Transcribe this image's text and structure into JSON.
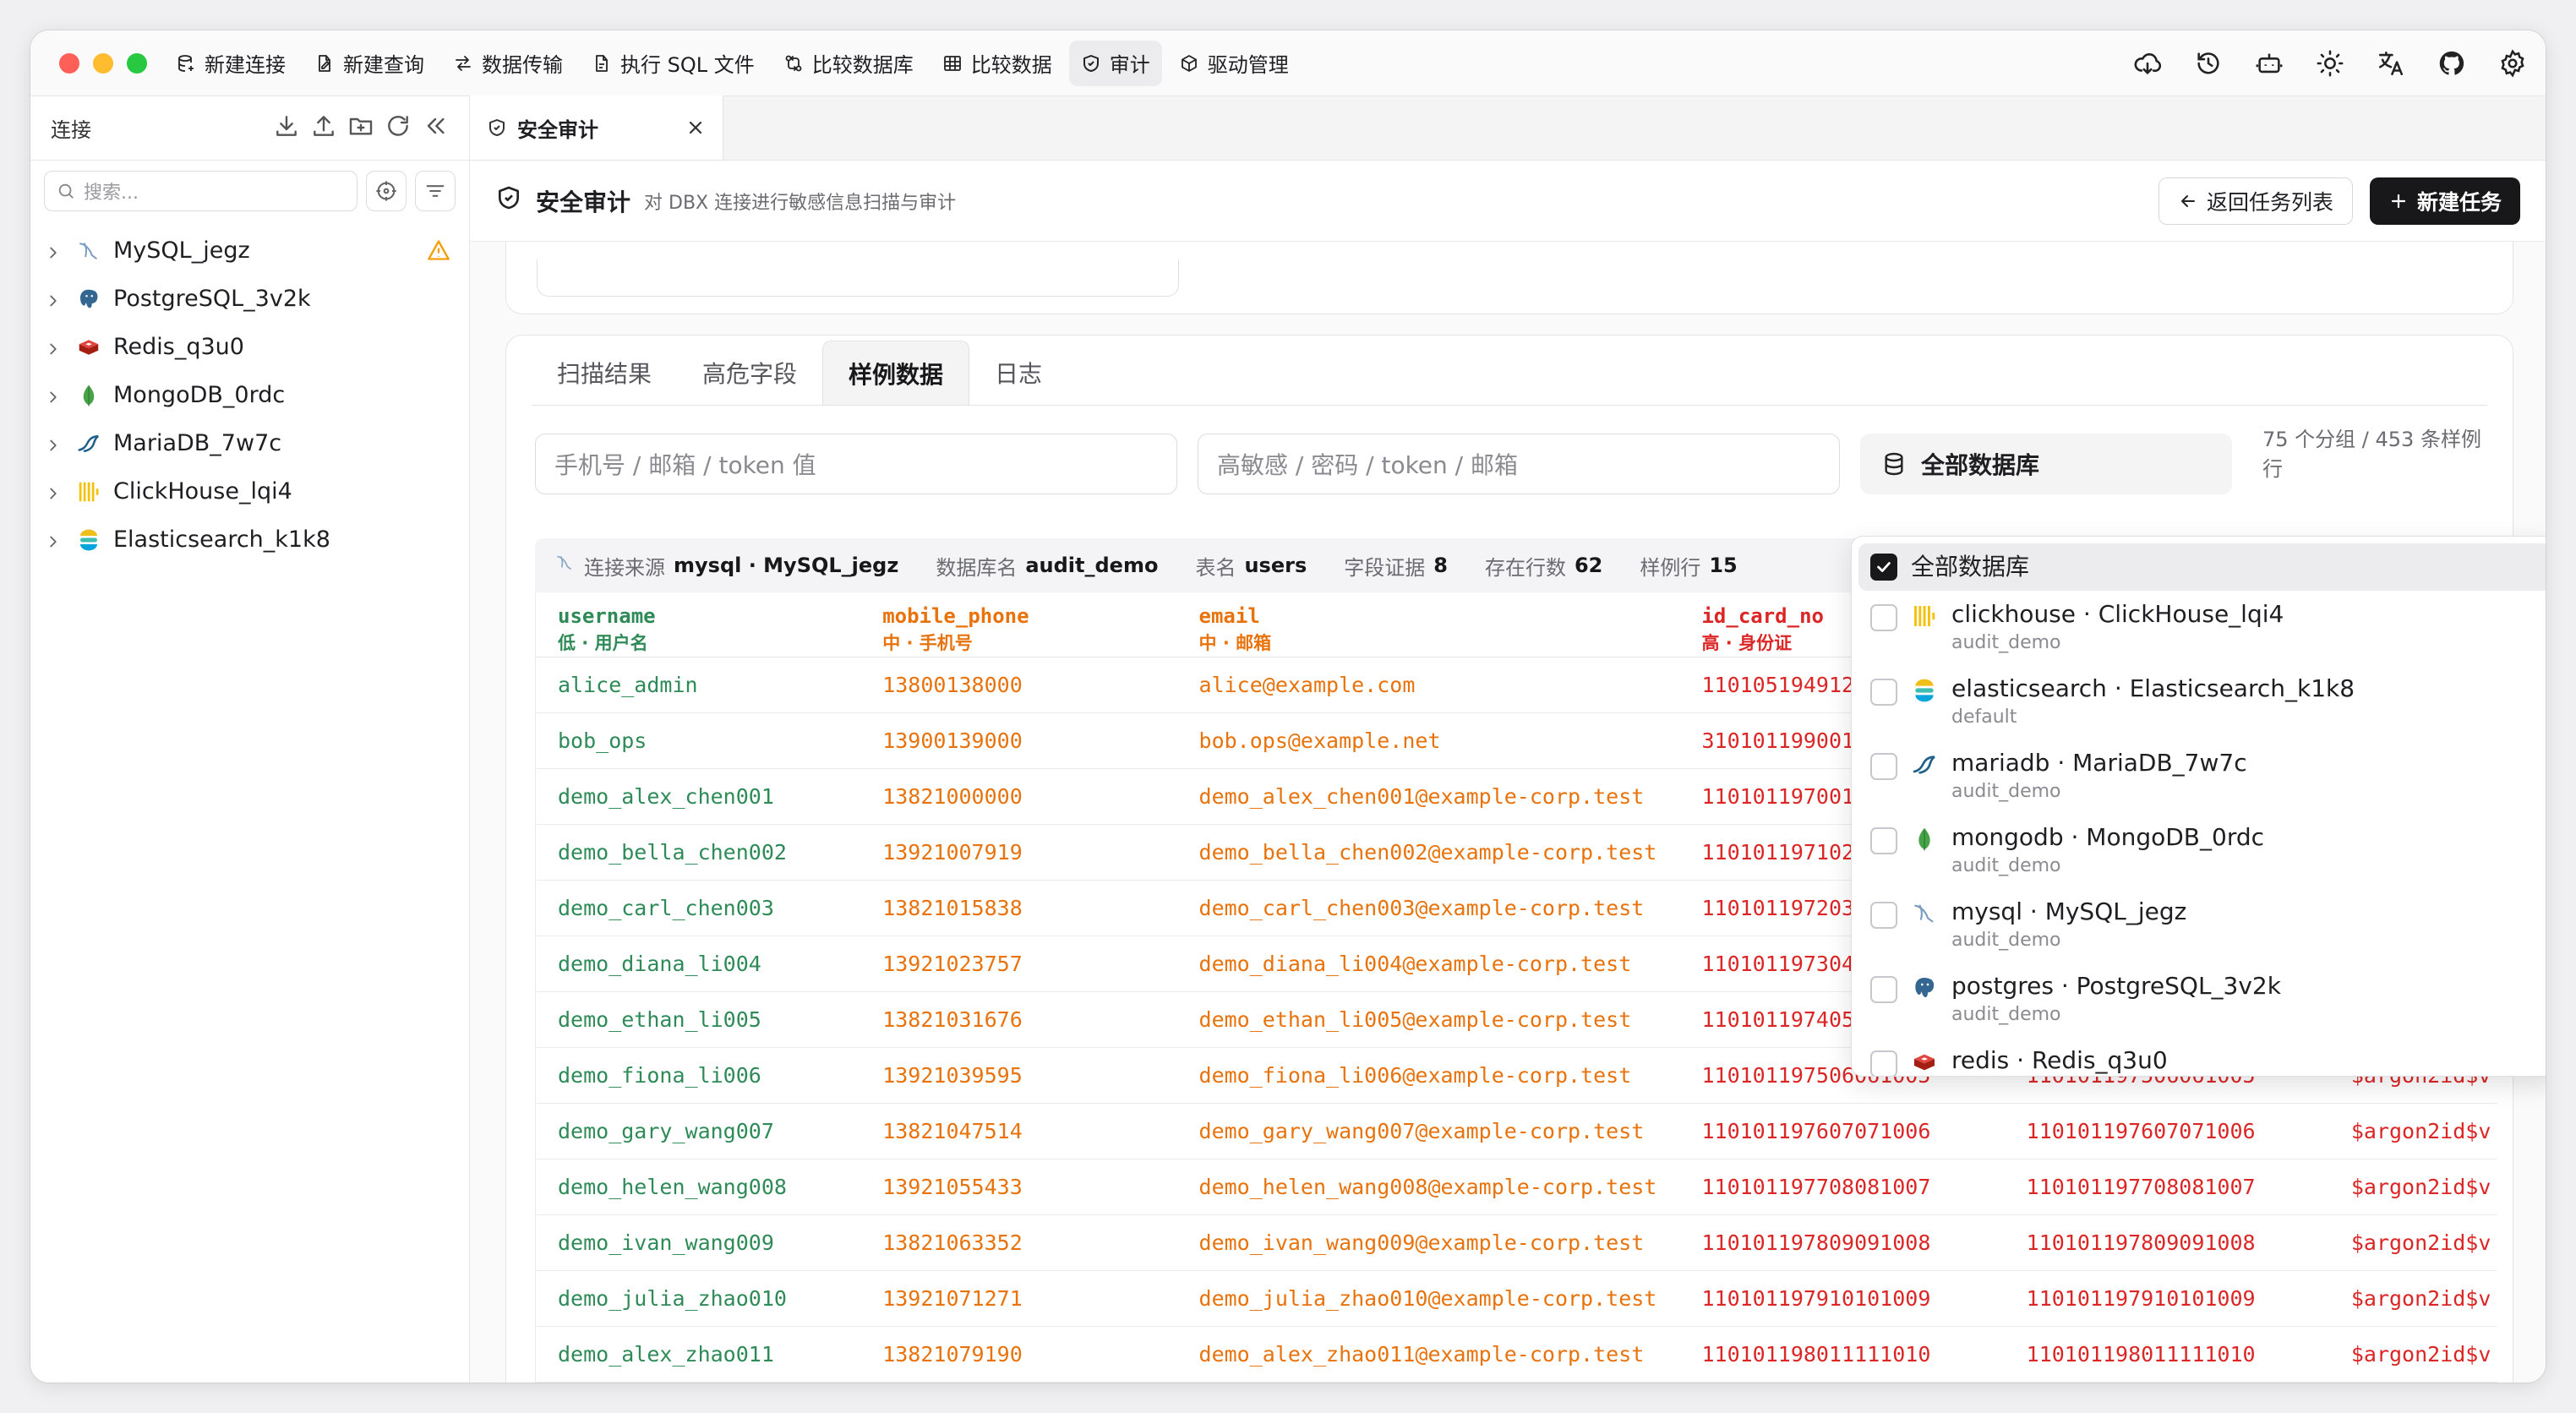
{
  "toolbar": {
    "items": [
      {
        "label": "新建连接",
        "icon": "database-plus-icon"
      },
      {
        "label": "新建查询",
        "icon": "file-edit-icon"
      },
      {
        "label": "数据传输",
        "icon": "transfer-icon"
      },
      {
        "label": "执行 SQL 文件",
        "icon": "sql-file-icon"
      },
      {
        "label": "比较数据库",
        "icon": "compare-db-icon"
      },
      {
        "label": "比较数据",
        "icon": "table-compare-icon"
      },
      {
        "label": "审计",
        "icon": "shield-icon"
      },
      {
        "label": "驱动管理",
        "icon": "package-icon"
      }
    ],
    "active_index": 6,
    "right_icons": [
      "cloud-sync-icon",
      "history-icon",
      "robot-icon",
      "sun-icon",
      "translate-icon",
      "github-icon",
      "settings-icon"
    ]
  },
  "sidebar": {
    "title": "连接",
    "search_placeholder": "搜索...",
    "connections": [
      {
        "name": "MySQL_jegz",
        "icon": "mysql-icon",
        "warning": true
      },
      {
        "name": "PostgreSQL_3v2k",
        "icon": "postgres-icon",
        "warning": false
      },
      {
        "name": "Redis_q3u0",
        "icon": "redis-icon",
        "warning": false
      },
      {
        "name": "MongoDB_0rdc",
        "icon": "mongodb-icon",
        "warning": false
      },
      {
        "name": "MariaDB_7w7c",
        "icon": "mariadb-icon",
        "warning": false
      },
      {
        "name": "ClickHouse_lqi4",
        "icon": "clickhouse-icon",
        "warning": false
      },
      {
        "name": "Elasticsearch_k1k8",
        "icon": "elasticsearch-icon",
        "warning": false
      }
    ]
  },
  "tab": {
    "label": "安全审计"
  },
  "page": {
    "title": "安全审计",
    "subtitle": "对 DBX 连接进行敏感信息扫描与审计",
    "back_button": "返回任务列表",
    "new_button": "新建任务"
  },
  "subtabs": [
    "扫描结果",
    "高危字段",
    "样例数据",
    "日志"
  ],
  "active_subtab": 2,
  "filters": {
    "search1_placeholder": "手机号 / 邮箱 / token 值",
    "search2_placeholder": "高敏感 / 密码 / token / 邮箱",
    "db_select": "全部数据库",
    "count": "75 个分组 / 453 条样例行"
  },
  "info": {
    "source_label": "连接来源",
    "source_value": "mysql · MySQL_jegz",
    "db_label": "数据库名",
    "db_value": "audit_demo",
    "table_label": "表名",
    "table_value": "users",
    "evidence_label": "字段证据",
    "evidence_value": "8",
    "rows_label": "存在行数",
    "rows_value": "62",
    "sample_label": "样例行",
    "sample_value": "15"
  },
  "colors": {
    "low": "#2e8b57",
    "medium": "#e8730c",
    "high": "#dc2626"
  },
  "table": {
    "columns": [
      {
        "name": "username",
        "sub": "低 · 用户名",
        "level": "low"
      },
      {
        "name": "mobile_phone",
        "sub": "中 · 手机号",
        "level": "medium"
      },
      {
        "name": "email",
        "sub": "中 · 邮箱",
        "level": "medium"
      },
      {
        "name": "id_card_no",
        "sub": "高 · 身份证",
        "level": "high"
      },
      {
        "name": "",
        "sub": "",
        "level": "high"
      },
      {
        "name": "",
        "sub": "",
        "level": "high"
      }
    ],
    "rows": [
      [
        "alice_admin",
        "13800138000",
        "alice@example.com",
        "110105194912310021",
        "",
        ""
      ],
      [
        "bob_ops",
        "13900139000",
        "bob.ops@example.net",
        "310101199001011234",
        "",
        ""
      ],
      [
        "demo_alex_chen001",
        "13821000000",
        "demo_alex_chen001@example-corp.test",
        "110101197001011000",
        "",
        ""
      ],
      [
        "demo_bella_chen002",
        "13921007919",
        "demo_bella_chen002@example-corp.test",
        "110101197102021001",
        "",
        ""
      ],
      [
        "demo_carl_chen003",
        "13821015838",
        "demo_carl_chen003@example-corp.test",
        "110101197203031002",
        "",
        ""
      ],
      [
        "demo_diana_li004",
        "13921023757",
        "demo_diana_li004@example-corp.test",
        "110101197304041003",
        "",
        ""
      ],
      [
        "demo_ethan_li005",
        "13821031676",
        "demo_ethan_li005@example-corp.test",
        "110101197405051004",
        "",
        ""
      ],
      [
        "demo_fiona_li006",
        "13921039595",
        "demo_fiona_li006@example-corp.test",
        "110101197506061005",
        "110101197506061005",
        "$argon2id$v"
      ],
      [
        "demo_gary_wang007",
        "13821047514",
        "demo_gary_wang007@example-corp.test",
        "110101197607071006",
        "110101197607071006",
        "$argon2id$v"
      ],
      [
        "demo_helen_wang008",
        "13921055433",
        "demo_helen_wang008@example-corp.test",
        "110101197708081007",
        "110101197708081007",
        "$argon2id$v"
      ],
      [
        "demo_ivan_wang009",
        "13821063352",
        "demo_ivan_wang009@example-corp.test",
        "110101197809091008",
        "110101197809091008",
        "$argon2id$v"
      ],
      [
        "demo_julia_zhao010",
        "13921071271",
        "demo_julia_zhao010@example-corp.test",
        "110101197910101009",
        "110101197910101009",
        "$argon2id$v"
      ],
      [
        "demo_alex_zhao011",
        "13821079190",
        "demo_alex_zhao011@example-corp.test",
        "110101198011111010",
        "110101198011111010",
        "$argon2id$v"
      ]
    ]
  },
  "dropdown": {
    "items": [
      {
        "title": "全部数据库",
        "sub": "",
        "checked": true,
        "icon": ""
      },
      {
        "title": "clickhouse · ClickHouse_lqi4",
        "sub": "audit_demo",
        "checked": false,
        "icon": "clickhouse-icon"
      },
      {
        "title": "elasticsearch · Elasticsearch_k1k8",
        "sub": "default",
        "checked": false,
        "icon": "elasticsearch-icon"
      },
      {
        "title": "mariadb · MariaDB_7w7c",
        "sub": "audit_demo",
        "checked": false,
        "icon": "mariadb-icon"
      },
      {
        "title": "mongodb · MongoDB_0rdc",
        "sub": "audit_demo",
        "checked": false,
        "icon": "mongodb-icon"
      },
      {
        "title": "mysql · MySQL_jegz",
        "sub": "audit_demo",
        "checked": false,
        "icon": "mysql-icon"
      },
      {
        "title": "postgres · PostgreSQL_3v2k",
        "sub": "audit_demo",
        "checked": false,
        "icon": "postgres-icon"
      },
      {
        "title": "redis · Redis_q3u0",
        "sub": "",
        "checked": false,
        "icon": "redis-icon"
      }
    ]
  }
}
